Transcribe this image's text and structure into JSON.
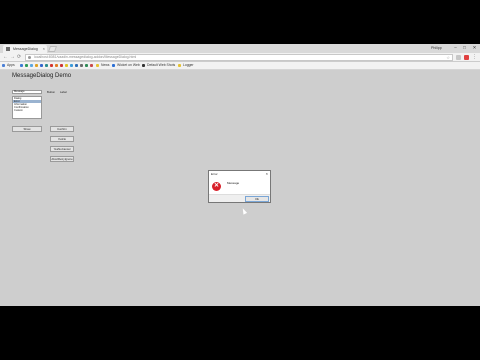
{
  "browser": {
    "tab_title": "MessageDialog Demo",
    "tab_close": "×",
    "user_label": "Philipp",
    "window_buttons": {
      "minimize": "–",
      "maximize": "□",
      "close": "✕"
    },
    "url": "localhost:8081/vaadin-messagedialog-addon/MessageDialog.html",
    "nav": {
      "back": "←",
      "forward": "→",
      "reload": "⟳"
    },
    "star": "☆",
    "menu": "⋮"
  },
  "bookmarks": {
    "apps": "Apps",
    "items": [
      "Vaadin",
      "Vaadin Directory",
      "Vaadin Forum",
      "Google",
      "Apps",
      "News",
      "Wicket on Web",
      "Github",
      "Default Web Shots",
      "Logger"
    ]
  },
  "page": {
    "title": "MessageDialog Demo",
    "message_input": "Message",
    "list_items": [
      "Dialog",
      "Error",
      "Information",
      "Confirmation",
      "Custom"
    ],
    "selected_index": 1,
    "label_button": "Button",
    "label_label": "Label",
    "buttons": {
      "show": "Show",
      "confirm": "Confirm",
      "yes_no": "YesNo",
      "yes_no_cancel": "YesNoCancel",
      "abort_retry": "AbortRetryIgnore"
    }
  },
  "dialog": {
    "title": "Error",
    "close": "×",
    "icon": "error-icon",
    "icon_glyph": "✕",
    "message": "Message",
    "ok": "Ok"
  }
}
